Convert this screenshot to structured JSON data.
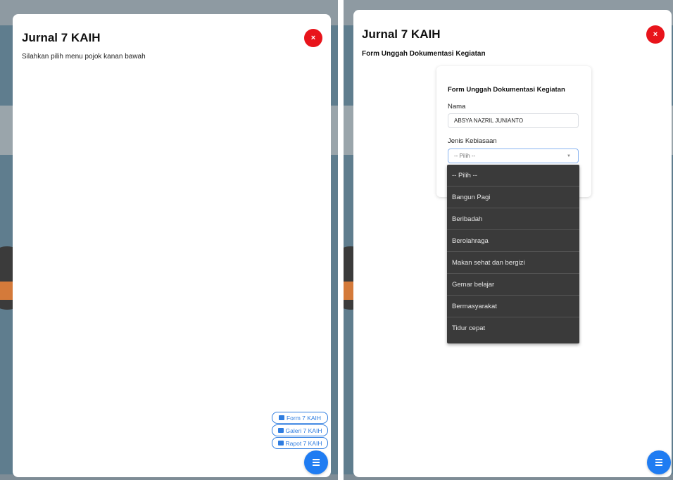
{
  "left": {
    "title": "Jurnal 7 KAIH",
    "close_label": "×",
    "instruction": "Silahkan pilih menu pojok kanan bawah",
    "menu": [
      {
        "label": "Form 7 KAIH",
        "icon": "edit-icon"
      },
      {
        "label": "Galeri 7 KAIH",
        "icon": "image-icon"
      },
      {
        "label": "Rapot 7 KAIH",
        "icon": "image-icon"
      }
    ]
  },
  "right": {
    "title": "Jurnal 7 KAIH",
    "close_label": "×",
    "subtitle": "Form Unggah Dokumentasi Kegiatan",
    "form": {
      "title": "Form Unggah Dokumentasi Kegiatan",
      "name_label": "Nama",
      "name_value": "ABSYA NAZRIL JUNIANTO",
      "habit_label": "Jenis Kebiasaan",
      "habit_selected": "-- Pilih --",
      "options": [
        "-- Pilih --",
        "Bangun Pagi",
        "Beribadah",
        "Berolahraga",
        "Makan sehat dan bergizi",
        "Gemar belajar",
        "Bermasyarakat",
        "Tidur cepat"
      ]
    }
  },
  "colors": {
    "accent": "#1f7cf2",
    "close": "#e8141b",
    "dropdown_bg": "#3a3a3a"
  }
}
